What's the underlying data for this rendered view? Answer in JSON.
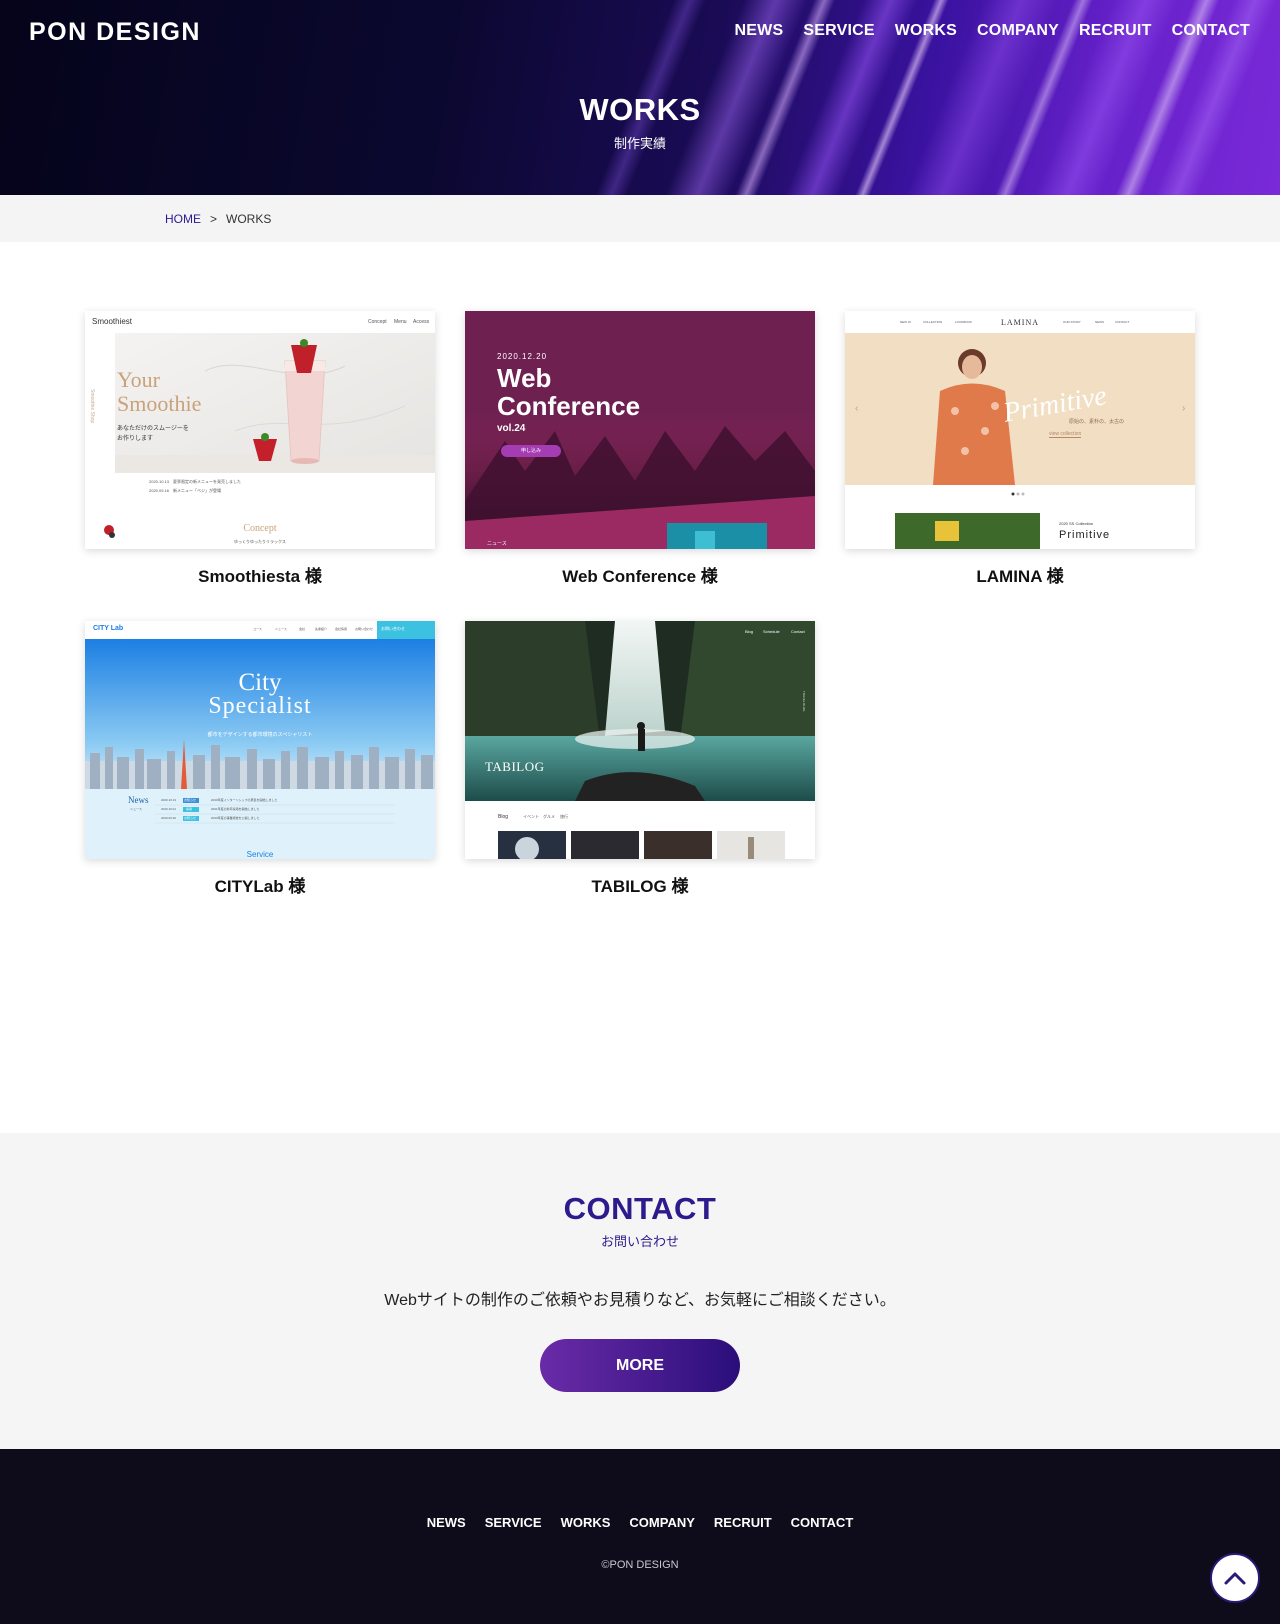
{
  "header": {
    "logo": "PON DESIGN",
    "nav": [
      "NEWS",
      "SERVICE",
      "WORKS",
      "COMPANY",
      "RECRUIT",
      "CONTACT"
    ]
  },
  "hero": {
    "title": "WORKS",
    "subtitle": "制作実績"
  },
  "breadcrumb": {
    "home": "HOME",
    "separator": ">",
    "current": "WORKS"
  },
  "works": [
    {
      "title": "Smoothiesta 様",
      "thumb": {
        "brand": "Smoothiest",
        "nav": [
          "Concept",
          "Menu",
          "Access"
        ],
        "headline1": "Your",
        "headline2": "Smoothie",
        "tagline1": "あなただけのスムージーを",
        "tagline2": "お作りします",
        "news1": "2020.10.13　夏季限定の新メニューを発売しました",
        "news2": "2020.09.16　新メニュー「ベジ」が登場",
        "section": "Concept",
        "section_sub": "ゆっくりゆったりリラックス",
        "vertical": "Smoothie Shop"
      }
    },
    {
      "title": "Web Conference 様",
      "thumb": {
        "date": "2020.12.20",
        "line1": "Web",
        "line2": "Conference",
        "vol": "vol.24",
        "button": "申し込み",
        "footer": "ニュース"
      }
    },
    {
      "title": "LAMINA 様",
      "thumb": {
        "brand": "LAMINA",
        "nav_left": [
          "NEW IN",
          "COLLECTION",
          "LOOKBOOK"
        ],
        "nav_right": [
          "OUR STORY",
          "NEWS",
          "CONTACT"
        ],
        "script": "Primitive",
        "jp": "原始の、素朴の、太古の",
        "link": "view collection",
        "collection_label": "2020 SS Collection",
        "collection": "Primitive"
      }
    },
    {
      "title": "CITYLab 様",
      "thumb": {
        "brand": "CITY Lab",
        "nav": [
          "コース",
          "ニュース",
          "会社",
          "先輩紹介",
          "会社情報",
          "お問い合わせ"
        ],
        "cta": "お問い合わせ",
        "headline1": "City",
        "headline2": "Specialist",
        "tagline": "都市をデザインする都市環境のスペシャリスト",
        "news_title": "News",
        "news_sub": "ニュース",
        "news": [
          {
            "date": "2020.10.13",
            "tag": "お知らせ",
            "text": "2020年度インターンシップの募集を開始しました"
          },
          {
            "date": "2020.10.01",
            "tag": "採用",
            "text": "2021年度の新卒採用を開始しました"
          },
          {
            "date": "2020.09.20",
            "tag": "お知らせ",
            "text": "2020年度の事業報告を公開しました"
          }
        ],
        "section": "Service"
      }
    },
    {
      "title": "TABILOG 様",
      "thumb": {
        "brand": "TABILOG",
        "nav": [
          "Blog",
          "Schedule",
          "Contact"
        ],
        "blog": "Blog",
        "tabs": [
          "イベント",
          "グルメ",
          "旅行"
        ],
        "vertical": "TRAVEL BLOG"
      }
    }
  ],
  "contact": {
    "title": "CONTACT",
    "subtitle": "お問い合わせ",
    "text": "Webサイトの制作のご依頼やお見積りなど、お気軽にご相談ください。",
    "button": "MORE"
  },
  "footer": {
    "nav": [
      "NEWS",
      "SERVICE",
      "WORKS",
      "COMPANY",
      "RECRUIT",
      "CONTACT"
    ],
    "copyright": "©PON DESIGN"
  },
  "colors": {
    "brand": "#2e1a8c",
    "accent": "#6a2ba8",
    "footer_bg": "#0e0c1b"
  }
}
